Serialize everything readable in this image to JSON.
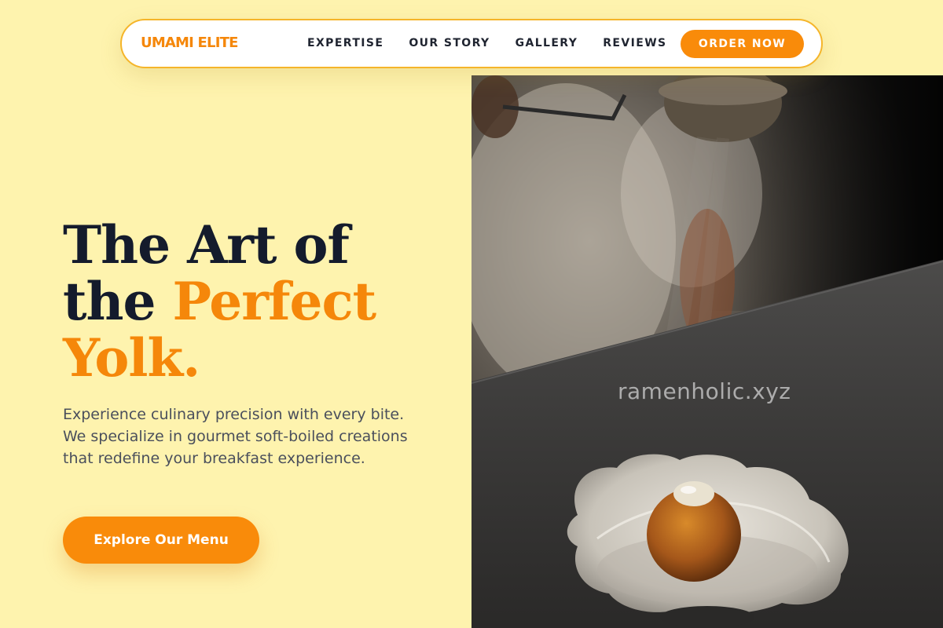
{
  "nav": {
    "logo": "UMAMI ELITE",
    "links": [
      "EXPERTISE",
      "OUR STORY",
      "GALLERY",
      "REVIEWS"
    ],
    "cta": "ORDER NOW"
  },
  "hero": {
    "title_line1": "The Art of",
    "title_line2_plain": "the ",
    "title_line2_accent": "Perfect",
    "title_line3_accent": "Yolk.",
    "description": "Experience culinary precision with every bite. We specialize in gourmet soft-boiled creations that redefine your breakfast experience.",
    "cta": "Explore Our Menu",
    "watermark": "ramenholic.xyz"
  },
  "colors": {
    "background": "#fef3ae",
    "accent": "#f98b0a",
    "heading": "#141b2c",
    "body_text": "#4a4f5c"
  }
}
